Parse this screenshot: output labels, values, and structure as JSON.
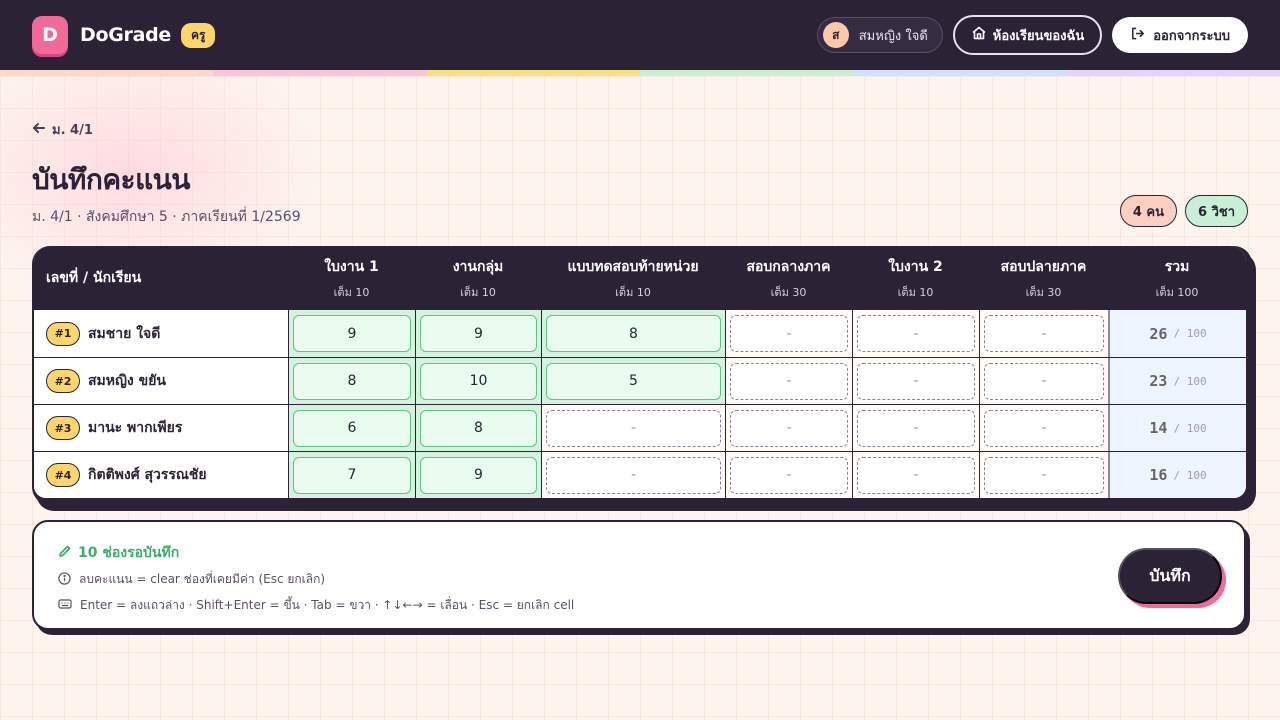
{
  "header": {
    "logo_letter": "D",
    "brand": "DoGrade",
    "role": "ครู",
    "user_initial": "ส",
    "user_name": "สมหญิง ใจดี",
    "my_classes_label": "ห้องเรียนของฉัน",
    "logout_label": "ออกจากระบบ",
    "rainbow_colors": [
      "#fcd8c8",
      "#fbc5d6",
      "#fce07c",
      "#c9efd3",
      "#cfe2fb",
      "#e4d4f7"
    ]
  },
  "page": {
    "back_label": "ม. 4/1",
    "title": "บันทึกคะแนน",
    "subtitle": "ม. 4/1 · สังคมศึกษา 5 · ภาคเรียนที่ 1/2569",
    "students_count": "4 คน",
    "subjects_count": "6 วิชา"
  },
  "table": {
    "name_header": "เลขที่ / นักเรียน",
    "columns": [
      {
        "title": "ใบงาน 1",
        "max": "เต็ม 10"
      },
      {
        "title": "งานกลุ่ม",
        "max": "เต็ม 10"
      },
      {
        "title": "แบบทดสอบท้ายหน่วย",
        "max": "เต็ม 10"
      },
      {
        "title": "สอบกลางภาค",
        "max": "เต็ม 30"
      },
      {
        "title": "ใบงาน 2",
        "max": "เต็ม 10"
      },
      {
        "title": "สอบปลายภาค",
        "max": "เต็ม 30"
      },
      {
        "title": "รวม",
        "max": "เต็ม 100"
      }
    ],
    "rows": [
      {
        "no": "#1",
        "name": "สมชาย ใจดี",
        "scores": [
          "9",
          "9",
          "8",
          "-",
          "-",
          "-"
        ],
        "total": "26",
        "total_max": "/ 100"
      },
      {
        "no": "#2",
        "name": "สมหญิง ขยัน",
        "scores": [
          "8",
          "10",
          "5",
          "-",
          "-",
          "-"
        ],
        "total": "23",
        "total_max": "/ 100"
      },
      {
        "no": "#3",
        "name": "มานะ พากเพียร",
        "scores": [
          "6",
          "8",
          "-",
          "-",
          "-",
          "-"
        ],
        "total": "14",
        "total_max": "/ 100"
      },
      {
        "no": "#4",
        "name": "กิตติพงศ์ สุวรรณชัย",
        "scores": [
          "7",
          "9",
          "-",
          "-",
          "-",
          "-"
        ],
        "total": "16",
        "total_max": "/ 100"
      }
    ]
  },
  "footer": {
    "pending": "10 ช่องรอบันทึก",
    "hint_clear": "ลบคะแนน = clear ช่องที่เคยมีค่า (Esc ยกเลิก)",
    "hint_keys": "Enter = ลงแถวล่าง · Shift+Enter = ขึ้น · Tab = ขวา · ↑↓←→ = เลื่อน · Esc = ยกเลิก cell",
    "save_label": "บันทึก"
  },
  "colors": {
    "dark": "#2b2236",
    "pink": "#f26a98",
    "yellow": "#fcd66a",
    "green": "#3cae6a"
  }
}
